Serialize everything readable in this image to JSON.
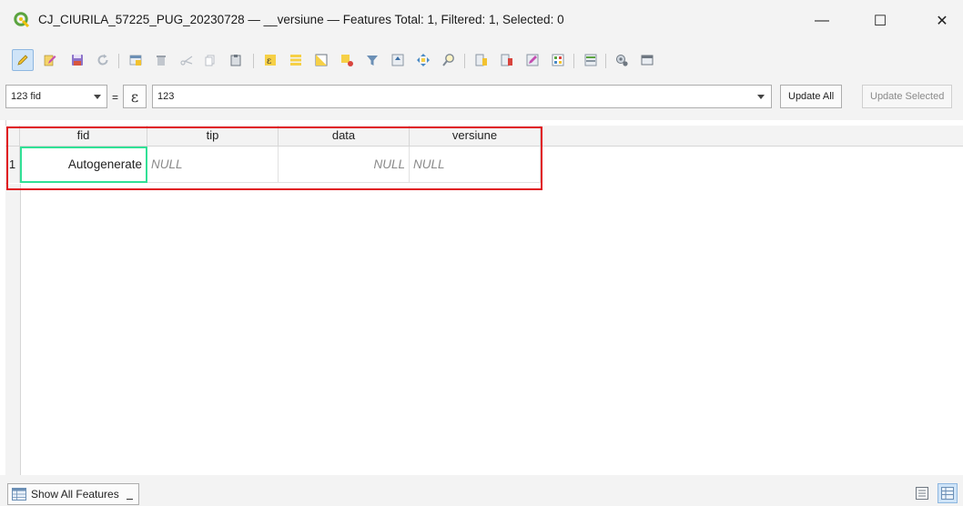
{
  "window": {
    "title": "CJ_CIURILA_57225_PUG_20230728 — __versiune — Features Total: 1, Filtered: 1, Selected: 0",
    "minimize_glyph": "—",
    "maximize_glyph": "☐",
    "close_glyph": "✕"
  },
  "toolbar": {
    "buttons": [
      "toggle-editing-icon",
      "multi-edit-icon",
      "save-edits-icon",
      "reload-icon",
      "add-feature-icon",
      "delete-feature-icon",
      "cut-icon",
      "copy-icon",
      "paste-icon",
      "expression-select-icon",
      "select-all-icon",
      "invert-selection-icon",
      "deselect-icon",
      "filter-selected-icon",
      "move-selection-top-icon",
      "pan-to-selection-icon",
      "zoom-to-selection-icon",
      "new-field-icon",
      "delete-field-icon",
      "field-calculator-icon",
      "conditional-formatting-icon",
      "dock-table-icon",
      "actions-icon",
      "form-view-icon"
    ]
  },
  "calc": {
    "field_value": "123 fid",
    "equals": "=",
    "epsilon": "ε",
    "expression_value": "123",
    "update_all_label": "Update All",
    "update_selected_label": "Update Selected"
  },
  "table": {
    "columns": [
      "fid",
      "tip",
      "data",
      "versiune"
    ],
    "rows": [
      {
        "num": "1",
        "fid": "Autogenerate",
        "tip": "NULL",
        "data": "NULL",
        "versiune": "NULL"
      }
    ]
  },
  "status": {
    "show_features_label": "Show All Features"
  },
  "colors": {
    "highlight_box": "#e0141d",
    "focus_cell": "#31e096",
    "qgis_green": "#5aa33f"
  }
}
